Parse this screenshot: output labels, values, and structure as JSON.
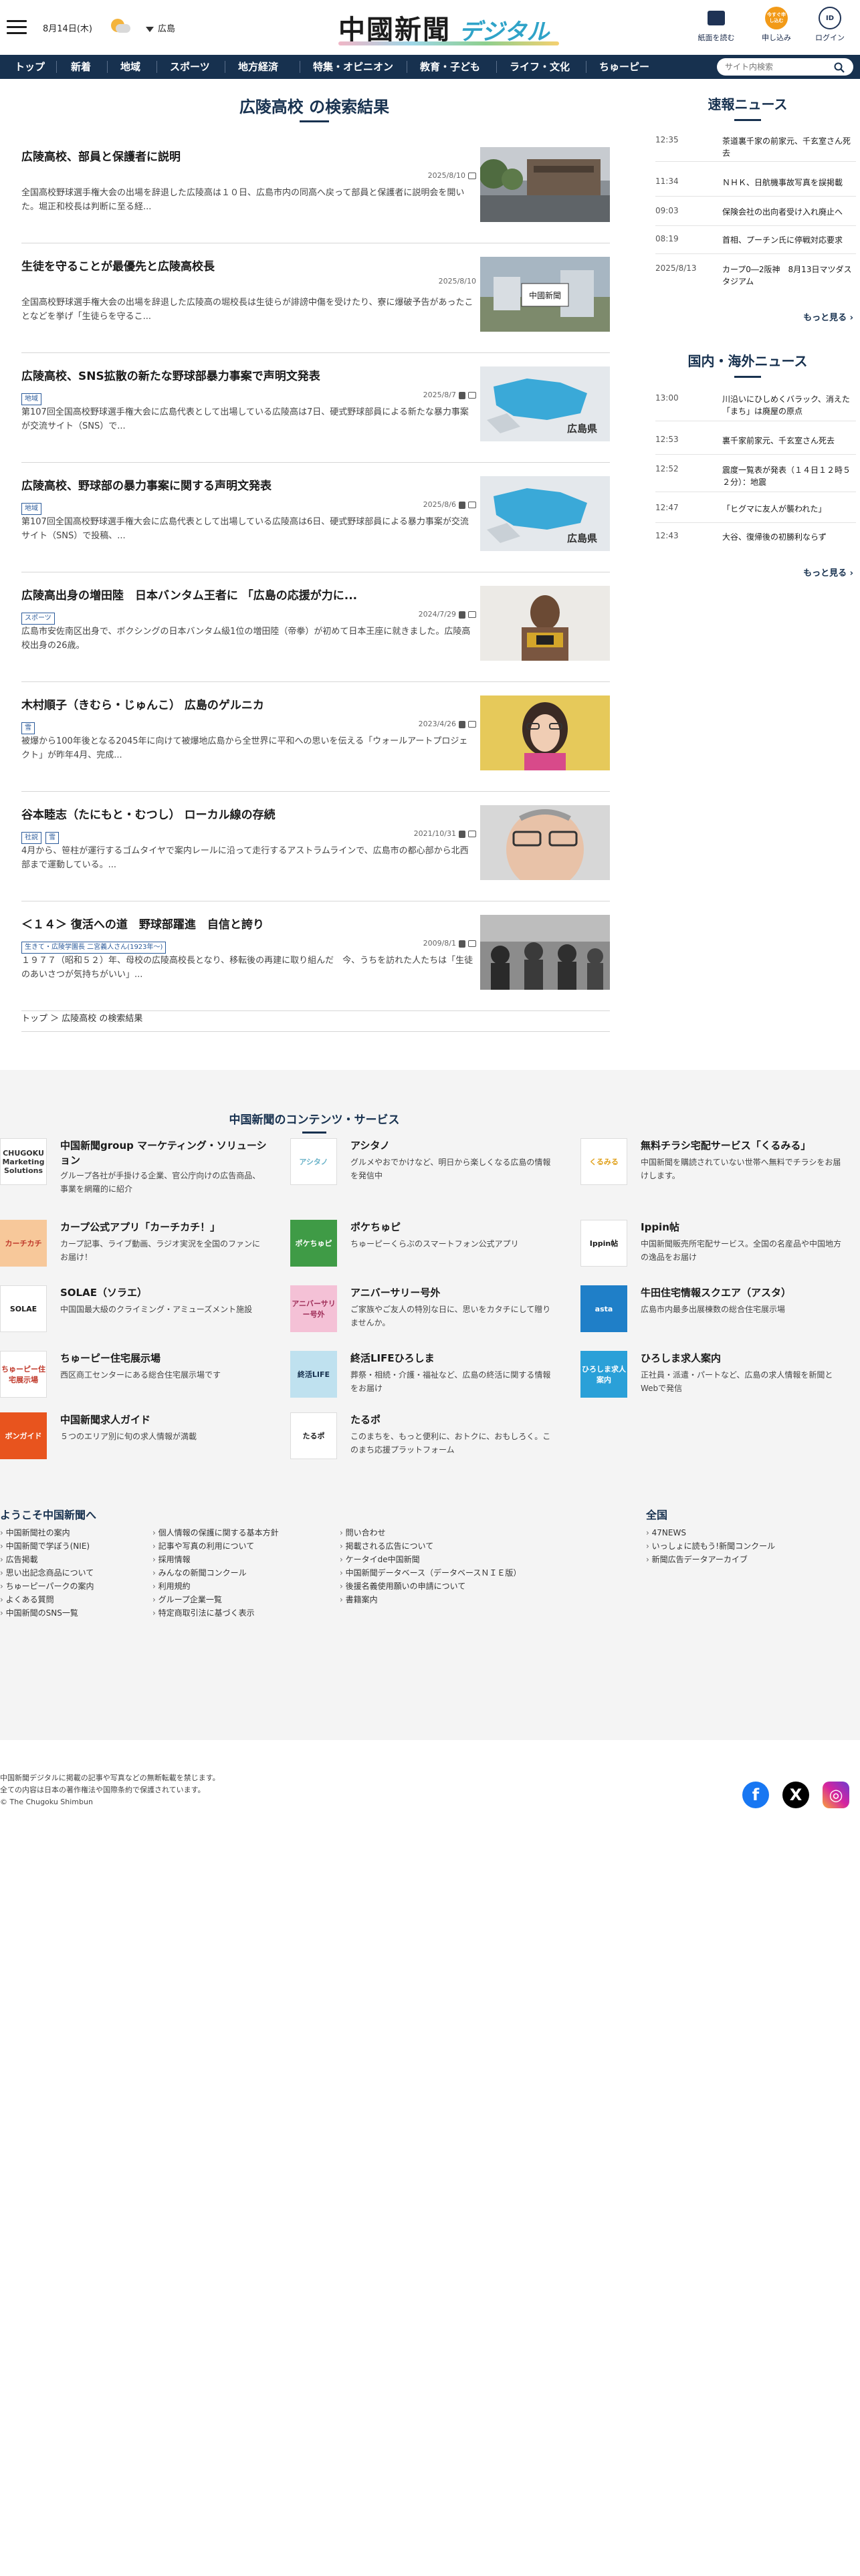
{
  "header": {
    "date": "8月14日(木)",
    "region": "広島",
    "logo_main": "中國新聞",
    "logo_sub": "デジタル",
    "actions": [
      {
        "label": "紙面を読む",
        "icon": "newspaper-icon"
      },
      {
        "label": "申し込み",
        "icon_text": "今すぐ申し込む"
      },
      {
        "label": "ログイン",
        "icon_text": "ID"
      }
    ]
  },
  "nav": {
    "items": [
      "トップ",
      "新着",
      "地域",
      "スポーツ",
      "地方経済",
      "特集・オピニオン",
      "教育・子ども",
      "ライフ・文化",
      "ちゅーピー"
    ],
    "search_placeholder": "サイト内検索"
  },
  "main": {
    "title": "広陵高校 の検索結果",
    "articles": [
      {
        "title": "広陵高校、部員と保護者に説明",
        "tags": [],
        "date": "2025/8/10",
        "excerpt": "全国高校野球選手権大会の出場を辞退した広陵高は１０日、広島市内の同高へ戻って部員と保護者に説明会を開いた。堀正和校長は判断に至る経..."
      },
      {
        "title": "生徒を守ることが最優先と広陵高校長",
        "tags": [],
        "date": "2025/8/10",
        "excerpt": "全国高校野球選手権大会の出場を辞退した広陵高の堀校長は生徒らが誹謗中傷を受けたり、寮に爆破予告があったことなどを挙げ「生徒らを守るこ..."
      },
      {
        "title": "広陵高校、SNS拡散の新たな野球部暴力事案で声明文発表",
        "tags": [
          "地域"
        ],
        "date": "2025/8/7",
        "excerpt": "第107回全国高校野球選手権大会に広島代表として出場している広陵高は7日、硬式野球部員による新たな暴力事案が交流サイト（SNS）で..."
      },
      {
        "title": "広陵高校、野球部の暴力事案に関する声明文発表",
        "tags": [
          "地域"
        ],
        "date": "2025/8/6",
        "excerpt": "第107回全国高校野球選手権大会に広島代表として出場している広陵高は6日、硬式野球部員による暴力事案が交流サイト（SNS）で投稿、..."
      },
      {
        "title": "広陵高出身の増田陸　日本バンタム王者に 「広島の応援が力に...",
        "tags": [
          "スポーツ"
        ],
        "date": "2024/7/29",
        "excerpt": "広島市安佐南区出身で、ボクシングの日本バンタム級1位の増田陸（帝拳）が初めて日本王座に就きました。広陵高校出身の26歳。"
      },
      {
        "title": "木村順子（きむら・じゅんこ） 広島のゲルニカ",
        "tags": [
          "雪"
        ],
        "date": "2023/4/26",
        "excerpt": "被爆から100年後となる2045年に向けて被爆地広島から全世界に平和への思いを伝える「ウォールアートプロジェクト」が昨年4月、完成..."
      },
      {
        "title": "谷本睦志（たにもと・むつし） ローカル線の存続",
        "tags": [
          "社説",
          "雪"
        ],
        "date": "2021/10/31",
        "excerpt": "4月から、笹柱が運行するゴムタイヤで案内レールに沿って走行するアストラムラインで、広島市の都心部から北西部まで運動している。..."
      },
      {
        "title": "＜１４＞ 復活への道　野球部躍進　自信と誇り",
        "tags": [
          "生きて・広陵学園長 二宮義人さん(1923年〜)"
        ],
        "date": "2009/8/1",
        "excerpt": "１９７７（昭和５２）年、母校の広陵高校長となり、移転後の再建に取り組んだ　今、うちを訪れた人たちは「生徒のあいさつが気持ちがいい」..."
      }
    ],
    "breadcrumb": "トップ ＞ 広陵高校 の検索結果"
  },
  "sidebar": {
    "breaking_title": "速報ニュース",
    "breaking": [
      {
        "time": "12:35",
        "text": "茶道裏千家の前家元、千玄室さん死去"
      },
      {
        "time": "11:34",
        "text": "ＮＨＫ、日航機事故写真を誤掲載"
      },
      {
        "time": "09:03",
        "text": "保険会社の出向者受け入れ廃止へ"
      },
      {
        "time": "08:19",
        "text": "首相、プーチン氏に停戦対応要求"
      },
      {
        "time": "2025/8/13",
        "text": "カープ0―2阪神　8月13日マツダスタジアム"
      }
    ],
    "more_label": "もっと見る",
    "national_title": "国内・海外ニュース",
    "national": [
      {
        "time": "13:00",
        "text": "川沿いにひしめくバラック、消えた「まち」は廃屋の原点"
      },
      {
        "time": "12:53",
        "text": "裏千家前家元、千玄室さん死去"
      },
      {
        "time": "12:52",
        "text": "震度一覧表が発表（１４日１２時５２分）：地震"
      },
      {
        "time": "12:47",
        "text": "「ヒグマに友人が襲われた」"
      },
      {
        "time": "12:43",
        "text": "大谷、復帰後の初勝利ならず"
      }
    ]
  },
  "footer": {
    "services_title": "中国新聞のコンテンツ・サービス",
    "services": [
      {
        "name": "中国新聞group マーケティング・ソリューション",
        "desc": "グループ各社が手掛ける企業、官公庁向けの広告商品、事業を網羅的に紹介",
        "logo": "CHUGOKU Marketing Solutions",
        "color": "#ffffff",
        "fg": "#333333"
      },
      {
        "name": "アシタノ",
        "desc": "グルメやおでかけなど、明日から楽しくなる広島の情報を発信中",
        "logo": "アシタノ",
        "color": "#ffffff",
        "fg": "#6bb3c9"
      },
      {
        "name": "無料チラシ宅配サービス「くるみる」",
        "desc": "中国新聞を購読されていない世帯へ無料でチラシをお届けします。",
        "logo": "くるみる",
        "color": "#ffffff",
        "fg": "#e0a01a"
      },
      {
        "name": "カープ公式アプリ「カーチカチ！」",
        "desc": "カープ記事、ライブ動画、ラジオ実況を全国のファンにお届け！",
        "logo": "カーチカチ",
        "color": "#f7c89a",
        "fg": "#c0392b"
      },
      {
        "name": "ポケちゅピ",
        "desc": "ちゅーピーくらぶのスマートフォン公式アプリ",
        "logo": "ポケちゅピ",
        "color": "#3f9b46",
        "fg": "#ffffff"
      },
      {
        "name": "Ippin帖",
        "desc": "中国新聞販売所宅配サービス。全国の名産品や中国地方の逸品をお届け",
        "logo": "Ippin帖",
        "color": "#ffffff",
        "fg": "#1a1a1a"
      },
      {
        "name": "SOLAE（ソラエ）",
        "desc": "中国国最大級のクライミング・アミューズメント施設",
        "logo": "SOLAE",
        "color": "#ffffff",
        "fg": "#1a1a1a"
      },
      {
        "name": "アニバーサリー号外",
        "desc": "ご家族やご友人の特別な日に、思いをカタチにして贈りませんか。",
        "logo": "アニバーサリー号外",
        "color": "#f4c1d6",
        "fg": "#a0305a"
      },
      {
        "name": "牛田住宅情報スクエア（アスタ）",
        "desc": "広島市内最多出展棟数の総合住宅展示場",
        "logo": "asta",
        "color": "#1f7fc8",
        "fg": "#ffffff"
      },
      {
        "name": "ちゅーピー住宅展示場",
        "desc": "西区商工センターにある総合住宅展示場です",
        "logo": "ちゅーピー住宅展示場",
        "color": "#ffffff",
        "fg": "#c0392b"
      },
      {
        "name": "終活LIFEひろしま",
        "desc": "葬祭・相続・介護・福祉など、広島の終活に関する情報をお届け",
        "logo": "終活LIFE",
        "color": "#bfe1ef",
        "fg": "#17314f"
      },
      {
        "name": "ひろしま求人案内",
        "desc": "正社員・派遣・パートなど、広島の求人情報を新聞とWebで発信",
        "logo": "ひろしま求人案内",
        "color": "#2aa0d8",
        "fg": "#ffffff"
      },
      {
        "name": "中国新聞求人ガイド",
        "desc": "５つのエリア別に旬の求人情報が満載",
        "logo": "ボンガイド",
        "color": "#e8541e",
        "fg": "#ffffff"
      },
      {
        "name": "たるポ",
        "desc": "このまちを、もっと便利に、おトクに、おもしろく。このまち応援プラットフォーム",
        "logo": "たるポ",
        "color": "#ffffff",
        "fg": "#1a1a1a"
      }
    ],
    "welcome_title": "ようこそ中国新聞へ",
    "welcome_cols": [
      [
        "中国新聞社の案内",
        "中国新聞で学ぼう(NIE)",
        "広告掲載",
        "思い出記念商品について",
        "ちゅーピーパークの案内",
        "よくある質問",
        "中国新聞のSNS一覧"
      ],
      [
        "個人情報の保護に関する基本方針",
        "記事や写真の利用について",
        "採用情報",
        "みんなの新聞コンクール",
        "利用規約",
        "グループ企業一覧",
        "特定商取引法に基づく表示"
      ],
      [
        "問い合わせ",
        "掲載される広告について",
        "ケータイde中国新聞",
        "中国新聞データベース（データベースＮＩＥ版）",
        "後援名義使用願いの申請について",
        "書籍案内"
      ]
    ],
    "global_title": "全国",
    "global_links": [
      "47NEWS",
      "いっしょに読もう!新聞コンクール",
      "新聞広告データアーカイブ"
    ],
    "copyright": [
      "中国新聞デジタルに掲載の記事や写真などの無断転載を禁じます。",
      "全ての内容は日本の著作権法や国際条約で保護されています。",
      "© The Chugoku Shimbun"
    ],
    "social": [
      {
        "name": "facebook",
        "label": "f",
        "color": "#1877f2"
      },
      {
        "name": "x",
        "label": "X",
        "color": "#000000"
      },
      {
        "name": "instagram",
        "label": "◎",
        "color": "#d6249f"
      }
    ]
  }
}
